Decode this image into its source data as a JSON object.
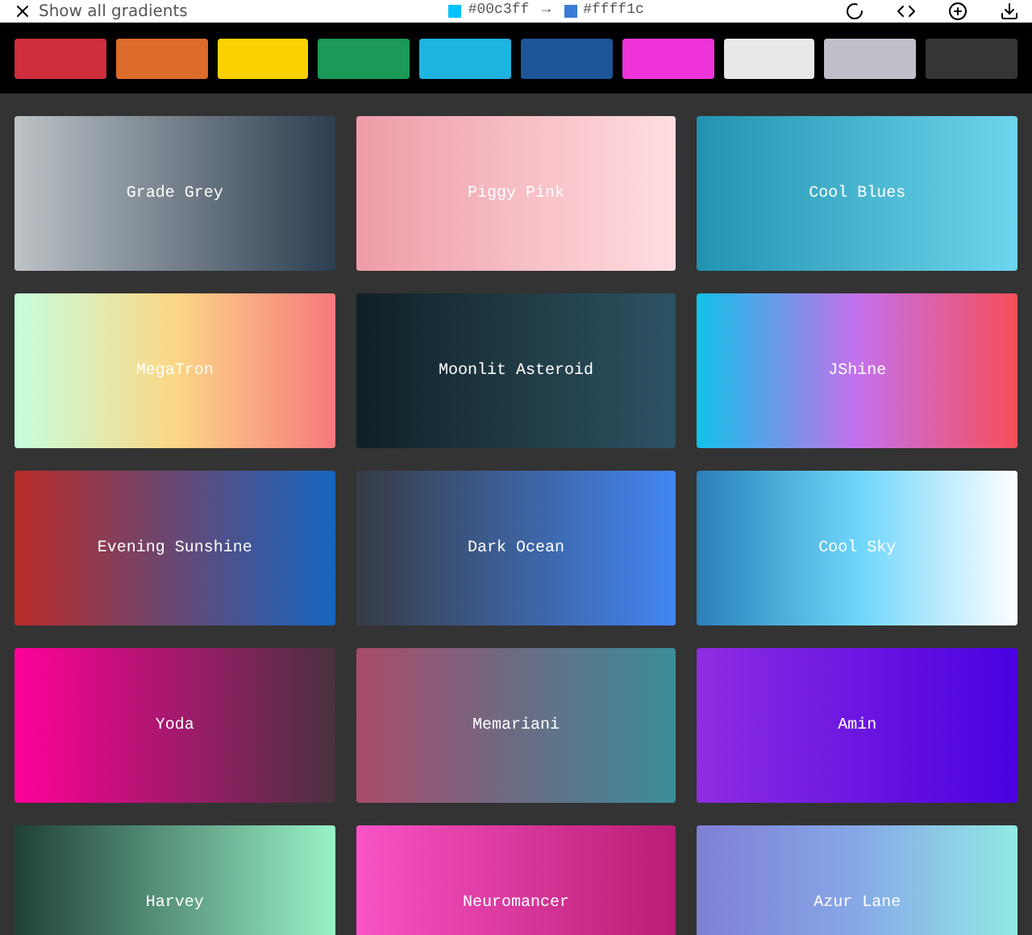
{
  "top_bar": {
    "show_all": "Show all gradients",
    "from": {
      "code": "#00c3ff",
      "color": "#00c3ff"
    },
    "arrow": "→",
    "to": {
      "code": "#ffff1c",
      "color": "#3a7bd5"
    }
  },
  "filter_swatches": [
    {
      "color": "#cf2e3c"
    },
    {
      "color": "#dd6b2b"
    },
    {
      "color": "#fdd000"
    },
    {
      "color": "#1a9a56"
    },
    {
      "color": "#1fb3e2"
    },
    {
      "color": "#1c5598"
    },
    {
      "color": "#ee34d8"
    },
    {
      "color": "#e8e8e8"
    },
    {
      "color": "#bfbfc9"
    },
    {
      "color": "#353535"
    }
  ],
  "cards": [
    {
      "name": "Grade Grey",
      "stops": [
        {
          "color": "#bdc3c7"
        },
        {
          "color": "#2c3e50"
        }
      ]
    },
    {
      "name": "Piggy Pink",
      "stops": [
        {
          "color": "#ee9ca7"
        },
        {
          "color": "#ffdde1"
        }
      ]
    },
    {
      "name": "Cool Blues",
      "stops": [
        {
          "color": "#2193b0"
        },
        {
          "color": "#6dd5ed"
        }
      ]
    },
    {
      "name": "MegaTron",
      "stops": [
        {
          "color": "#c6ffdd"
        },
        {
          "color": "#fbd786"
        },
        {
          "color": "#f7797d"
        }
      ]
    },
    {
      "name": "Moonlit Asteroid",
      "stops": [
        {
          "color": "#0f2027"
        },
        {
          "color": "#203a43"
        },
        {
          "color": "#2c5364"
        }
      ]
    },
    {
      "name": "JShine",
      "stops": [
        {
          "color": "#12c2e9"
        },
        {
          "color": "#c471ed"
        },
        {
          "color": "#f64f59"
        }
      ]
    },
    {
      "name": "Evening Sunshine",
      "stops": [
        {
          "color": "#b92b27"
        },
        {
          "color": "#1565c0"
        }
      ]
    },
    {
      "name": "Dark Ocean",
      "stops": [
        {
          "color": "#373b44"
        },
        {
          "color": "#4286f4"
        }
      ]
    },
    {
      "name": "Cool Sky",
      "stops": [
        {
          "color": "#2980b9"
        },
        {
          "color": "#6dd5fa"
        },
        {
          "color": "#ffffff"
        }
      ]
    },
    {
      "name": "Yoda",
      "stops": [
        {
          "color": "#ff0099"
        },
        {
          "color": "#493240"
        }
      ]
    },
    {
      "name": "Memariani",
      "stops": [
        {
          "color": "#aa4b6b"
        },
        {
          "color": "#6b6b83"
        },
        {
          "color": "#3b8d99"
        }
      ]
    },
    {
      "name": "Amin",
      "stops": [
        {
          "color": "#8e2de2"
        },
        {
          "color": "#4a00e0"
        }
      ]
    },
    {
      "name": "Harvey",
      "stops": [
        {
          "color": "#1f4037"
        },
        {
          "color": "#99f2c8"
        }
      ]
    },
    {
      "name": "Neuromancer",
      "stops": [
        {
          "color": "#f953c6"
        },
        {
          "color": "#b91d73"
        }
      ]
    },
    {
      "name": "Azur Lane",
      "stops": [
        {
          "color": "#7f7fd5"
        },
        {
          "color": "#86a8e7"
        },
        {
          "color": "#91eae4"
        }
      ]
    }
  ]
}
